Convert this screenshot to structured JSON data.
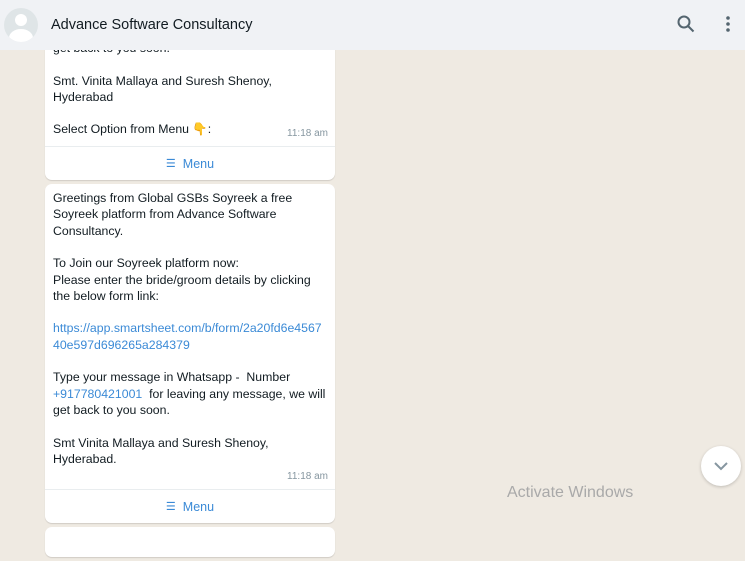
{
  "header": {
    "title": "Advance Software Consultancy",
    "icons": [
      "search-icon",
      "menu-kebab-icon"
    ]
  },
  "messages": [
    {
      "lines": "get back to you soon.\n\nSmt. Vinita Mallaya and Suresh Shenoy, Hyderabad\n\nSelect Option from Menu 👇:",
      "time": "11:18 am",
      "menu_label": "Menu"
    },
    {
      "part1": "Greetings from Global GSBs Soyreek a free Soyreek platform from Advance Software Consultancy.\n\nTo Join our Soyreek platform now:\nPlease enter the bride/groom details by clicking the below form link:\n\n",
      "link": "https://app.smartsheet.com/b/form/2a20fd6e456740e597d696265a284379",
      "part2": "\n\nType your message in Whatsapp -  Number\n",
      "phone": "+917780421001",
      "part3": "  for leaving any message, we will get back to you soon.\n\nSmt Vinita Mallaya and Suresh Shenoy, Hyderabad.",
      "time": "11:18 am",
      "menu_label": "Menu"
    }
  ],
  "watermark": "Activate Windows"
}
